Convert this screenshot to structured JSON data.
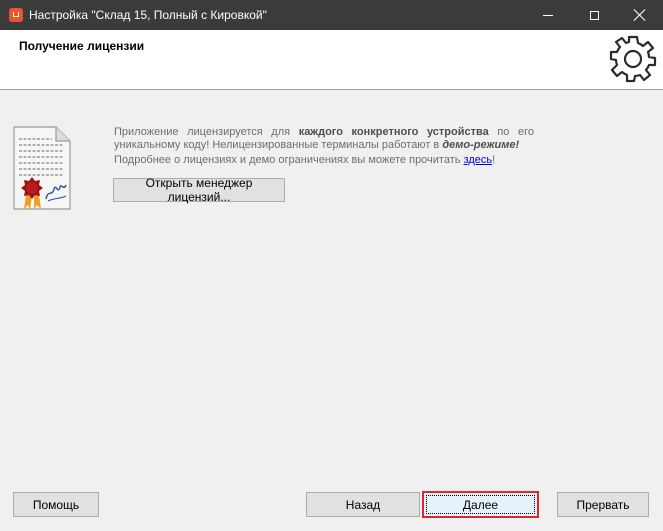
{
  "window": {
    "title": "Настройка \"Склад 15, Полный с Кировкой\"",
    "controls": [
      "minimize",
      "maximize",
      "close"
    ]
  },
  "header": {
    "title": "Получение лицензии",
    "icon": "gear-icon"
  },
  "content": {
    "icon": "certificate-document-icon",
    "line1_start": "Приложение лицензируется для ",
    "line1_bold": "каждого конкретного устройства",
    "line1_end": " по его уникальному коду! Нелицензированные терминалы работают в ",
    "line1_demo": "демо-режиме!",
    "line2_start": "Подробнее о лицензиях и демо ограничениях вы можете прочитать ",
    "line2_link": "здесь",
    "line2_end": "!",
    "open_manager_button": "Открыть менеджер лицензий..."
  },
  "footer": {
    "help": "Помощь",
    "back": "Назад",
    "next": "Далее",
    "cancel": "Прервать"
  },
  "colors": {
    "titlebar": "#3b3b3b",
    "focus_highlight": "#d9282f",
    "link": "#0000ee"
  }
}
